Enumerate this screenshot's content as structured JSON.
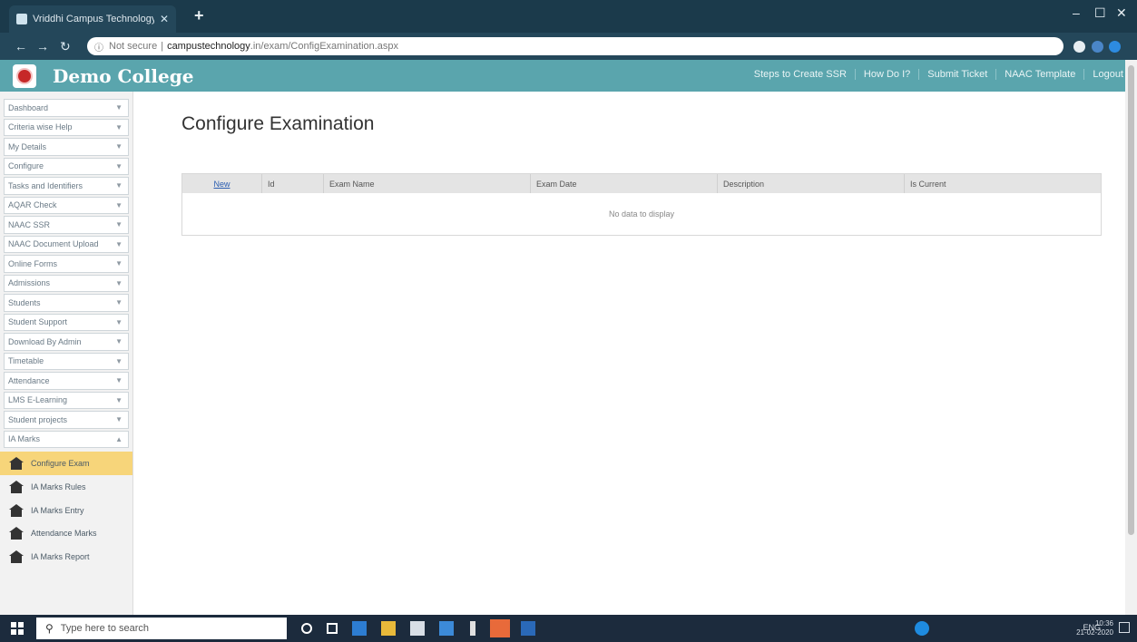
{
  "browser": {
    "tab_title": "Vriddhi Campus Technology",
    "url_not_secure": "Not secure",
    "url_host": "campustechnology",
    "url_path": ".in/exam/ConfigExamination.aspx"
  },
  "header": {
    "college_name": "Demo College",
    "links": [
      "Steps to Create SSR",
      "How Do I?",
      "Submit Ticket",
      "NAAC Template",
      "Logout"
    ]
  },
  "sidebar": {
    "items": [
      "Dashboard",
      "Criteria wise Help",
      "My Details",
      "Configure",
      "Tasks and Identifiers",
      "AQAR Check",
      "NAAC SSR",
      "NAAC Document Upload",
      "Online Forms",
      "Admissions",
      "Students",
      "Student Support",
      "Download By Admin",
      "Timetable",
      "Attendance",
      "LMS E-Learning",
      "Student projects",
      "IA Marks"
    ],
    "subitems": [
      "Configure Exam",
      "IA Marks Rules",
      "IA Marks Entry",
      "Attendance Marks",
      "IA Marks Report"
    ]
  },
  "main": {
    "title": "Configure Examination",
    "columns": [
      "New",
      "Id",
      "Exam Name",
      "Exam Date",
      "Description",
      "Is Current"
    ],
    "empty_text": "No data to display"
  },
  "taskbar": {
    "search_placeholder": "Type here to search",
    "tray_lang": "ENG",
    "time": "10:36",
    "date": "21-02-2020"
  }
}
